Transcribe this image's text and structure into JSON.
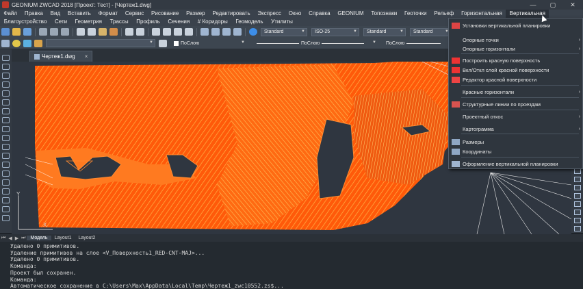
{
  "window": {
    "title": "GEONIUM ZWCAD 2018 [Проект: Тест] - [Чертеж1.dwg]",
    "minimize": "—",
    "maximize": "▢",
    "close": "✕"
  },
  "menubar1": [
    "Файл",
    "Правка",
    "Вид",
    "Вставить",
    "Формат",
    "Сервис",
    "Рисование",
    "Размер",
    "Редактировать",
    "Экспресс",
    "Окно",
    "Справка",
    "GEONIUM",
    "Топознаки",
    "Геоточки",
    "Рельеф",
    "Горизонтальная",
    "Вертикальная"
  ],
  "menubar2": [
    "Благоустройство",
    "Сети",
    "Геометрия",
    "Трассы",
    "Профиль",
    "Сечения",
    "# Коридоры",
    "Геомодель",
    "Утилиты"
  ],
  "toolbar": {
    "text_style": "Standard",
    "dim_style": "ISO-25",
    "table_style": "Standard",
    "multileader_style": "Standard",
    "layer_color": "ПоСлою",
    "linetype": "ПоСлою",
    "lineweight": "ПоСлою"
  },
  "document_tab": {
    "label": "Чертеж1.dwg",
    "close": "×"
  },
  "layout_tabs": {
    "nav": [
      "⏮",
      "◀",
      "▶",
      "⏭"
    ],
    "tabs": [
      "Модель",
      "Layout1",
      "Layout2"
    ],
    "active": "Модель"
  },
  "ucs": {
    "x": "X",
    "y": "Y"
  },
  "command_lines": [
    "Удалено 0 примитивов.",
    "Удаление примитивов на слое <V_Поверхность1_RED-CNT-MAJ>...",
    "Удалено 0 примитивов.",
    "Команда:",
    "Проект был сохранен.",
    "Команда:",
    "Автоматическое сохранение в C:\\Users\\Max\\AppData\\Local\\Temp\\Чертеж1_zwc10552.zs$..."
  ],
  "dropdown": {
    "items": [
      {
        "label": "Установки вертикальной планировки",
        "icon": "settings-icon",
        "submenu": false
      },
      {
        "label": "Опорные точки",
        "icon": "",
        "submenu": true
      },
      {
        "label": "Опорные горизонтали",
        "icon": "",
        "submenu": true
      },
      {
        "label": "Построить красную поверхность",
        "icon": "red-surface-icon",
        "submenu": false
      },
      {
        "label": "Вкл/Откл слой красной поверхности",
        "icon": "layer-toggle-icon",
        "submenu": false
      },
      {
        "label": "Редактор красной поверхности",
        "icon": "surface-editor-icon",
        "submenu": false
      },
      {
        "label": "Красные горизонтали",
        "icon": "",
        "submenu": true
      },
      {
        "label": "Структурные линии по проездам",
        "icon": "structure-lines-icon",
        "submenu": false
      },
      {
        "label": "Проектный откос",
        "icon": "",
        "submenu": true
      },
      {
        "label": "Картограмма",
        "icon": "",
        "submenu": true
      },
      {
        "label": "Размеры",
        "icon": "dimensions-icon",
        "submenu": false
      },
      {
        "label": "Координаты",
        "icon": "coordinates-icon",
        "submenu": false
      },
      {
        "label": "Оформление вертикальной планировки",
        "icon": "layout-design-icon",
        "submenu": false
      }
    ],
    "submenu_arrow": "›"
  },
  "colors": {
    "accent_contour": "#ff6a12",
    "contour_light": "#ffb347",
    "background": "#2f3640",
    "menu_bg": "#3a424c"
  }
}
